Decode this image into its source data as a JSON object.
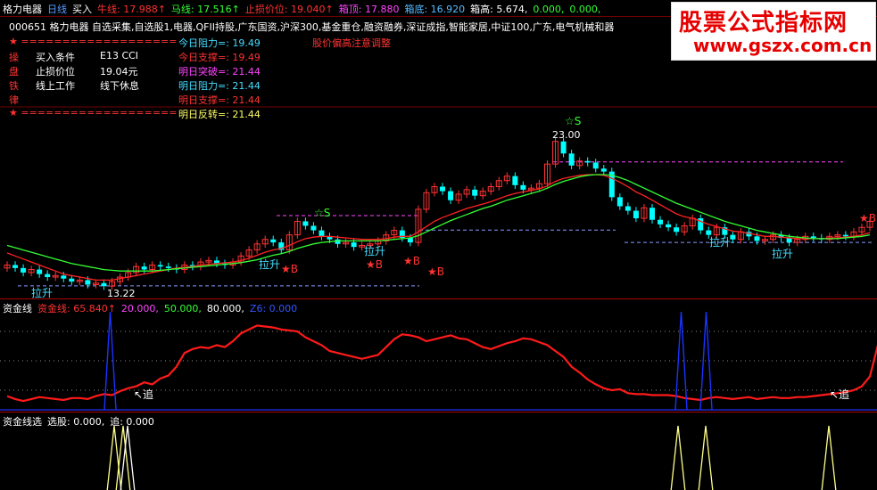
{
  "header": {
    "row1": [
      {
        "text": "格力电器",
        "color": "#ffffff"
      },
      {
        "text": "日线",
        "color": "#5599ff"
      },
      {
        "text": "买入",
        "color": "#ffffff"
      },
      {
        "text": "牛线: 17.988↑",
        "color": "#ff3333"
      },
      {
        "text": "马线: 17.516↑",
        "color": "#33ff33"
      },
      {
        "text": "止损价位: 19.040↑",
        "color": "#ff3333"
      },
      {
        "text": "箱顶: 17.880",
        "color": "#ff44ff"
      },
      {
        "text": "箱底: 16.920",
        "color": "#55bbff"
      },
      {
        "text": "箱高: 5.674,",
        "color": "#ffffff"
      },
      {
        "text": "0.000,",
        "color": "#33ff33"
      },
      {
        "text": "0.000,",
        "color": "#33ff33"
      }
    ],
    "row2": "000651  格力电器  自选采集,自选股1,电器,QFII持股,广东国资,沪深300,基金重仓,融资融券,深证成指,智能家居,中证100,广东,电气机械和器"
  },
  "info_left": {
    "rule1": "★ ===================",
    "lines": [
      {
        "char": "操",
        "a": "买入条件",
        "b": "E13 CCI"
      },
      {
        "char": "盘",
        "a": "止损价位",
        "b": "19.04元"
      },
      {
        "char": "铁",
        "a": "线上工作",
        "b": "线下休息"
      },
      {
        "char": "律",
        "a": "",
        "b": ""
      }
    ],
    "rule2": "★ ==================="
  },
  "info_right": [
    {
      "text": "今日阻力=: 19.49",
      "color": "#44ddff"
    },
    {
      "text": "今日支撑=: 19.49",
      "color": "#ff3333"
    },
    {
      "text": "明日突破=: 21.44",
      "color": "#ff44ff"
    },
    {
      "text": "明日阻力=: 21.44",
      "color": "#44ddff"
    },
    {
      "text": "明日支撑=: 21.44",
      "color": "#ff3333"
    },
    {
      "text": "明日反转=: 21.44",
      "color": "#ffff66"
    }
  ],
  "notice": "股价偏高注意调整",
  "logo": {
    "line1": "股票公式指标网",
    "line2": "www.gszx.com.cn"
  },
  "annotations": {
    "peak": "23.00",
    "low": "13.22",
    "lashen": "拉升",
    "star_s": "☆S",
    "star_b": "★B"
  },
  "panel2_header": [
    {
      "text": "资金线",
      "color": "#ffffff"
    },
    {
      "text": "资金线: 65.840↑",
      "color": "#ff3333"
    },
    {
      "text": "20.000,",
      "color": "#ff44ff"
    },
    {
      "text": "50.000,",
      "color": "#33ff33"
    },
    {
      "text": "80.000,",
      "color": "#ffffff"
    },
    {
      "text": "Z6: 0.000",
      "color": "#3355ff"
    }
  ],
  "panel2_label": "追",
  "panel3_header": [
    {
      "text": "资金线选",
      "color": "#ffffff"
    },
    {
      "text": "选股: 0.000,",
      "color": "#ffffff"
    },
    {
      "text": "追: 0.000",
      "color": "#ffffff"
    }
  ],
  "colors": {
    "up": "#ff3333",
    "down": "#00ffff",
    "ma_fast": "#ff2222",
    "ma_slow": "#33ff33",
    "capital": "#ff1a1a",
    "signal": "#1a33ff",
    "select": "#ffff88"
  },
  "chart_data": [
    {
      "type": "candlestick",
      "title": "格力电器 日线",
      "ylim": [
        12.5,
        24.5
      ],
      "closes": [
        14.6,
        14.4,
        14.1,
        14.3,
        14.0,
        13.8,
        13.9,
        13.7,
        13.5,
        13.6,
        13.3,
        13.4,
        13.2,
        13.5,
        13.8,
        14.1,
        14.5,
        14.3,
        14.6,
        14.5,
        14.4,
        14.3,
        14.6,
        14.5,
        14.8,
        14.9,
        14.7,
        14.6,
        14.8,
        15.2,
        15.6,
        16.0,
        16.3,
        16.1,
        15.6,
        16.6,
        17.5,
        17.2,
        16.9,
        16.5,
        16.3,
        16.0,
        16.1,
        15.8,
        15.9,
        16.0,
        16.2,
        16.6,
        16.9,
        16.4,
        16.1,
        18.3,
        19.4,
        19.8,
        19.5,
        18.9,
        19.3,
        19.6,
        19.2,
        19.5,
        19.8,
        20.2,
        20.5,
        19.9,
        19.6,
        19.7,
        20.0,
        21.3,
        22.8,
        22.0,
        21.2,
        21.5,
        21.4,
        21.0,
        20.8,
        19.1,
        18.5,
        18.2,
        17.7,
        18.4,
        17.6,
        17.3,
        17.1,
        16.8,
        17.2,
        17.7,
        16.9,
        16.6,
        17.1,
        16.6,
        16.3,
        16.8,
        16.5,
        16.2,
        16.3,
        16.6,
        16.4,
        16.1,
        16.3,
        16.5,
        16.4,
        16.3,
        16.5,
        16.6,
        16.5,
        16.8,
        17.1,
        17.5
      ],
      "ma_fast": [
        15.4,
        15.2,
        15.0,
        14.8,
        14.6,
        14.4,
        14.2,
        14.0,
        13.9,
        13.8,
        13.7,
        13.6,
        13.6,
        13.6,
        13.7,
        13.8,
        13.9,
        14.0,
        14.1,
        14.2,
        14.3,
        14.4,
        14.45,
        14.5,
        14.6,
        14.65,
        14.7,
        14.75,
        14.8,
        14.9,
        15.05,
        15.25,
        15.45,
        15.6,
        15.7,
        15.9,
        16.15,
        16.35,
        16.45,
        16.5,
        16.5,
        16.45,
        16.4,
        16.35,
        16.3,
        16.3,
        16.3,
        16.35,
        16.45,
        16.5,
        16.5,
        16.8,
        17.15,
        17.5,
        17.75,
        17.95,
        18.15,
        18.35,
        18.5,
        18.65,
        18.8,
        19.0,
        19.2,
        19.35,
        19.45,
        19.55,
        19.65,
        19.85,
        20.15,
        20.35,
        20.45,
        20.55,
        20.6,
        20.6,
        20.55,
        20.35,
        20.1,
        19.8,
        19.45,
        19.2,
        18.9,
        18.6,
        18.3,
        18.0,
        17.8,
        17.7,
        17.5,
        17.3,
        17.15,
        17.0,
        16.85,
        16.8,
        16.7,
        16.6,
        16.5,
        16.5,
        16.45,
        16.4,
        16.35,
        16.35,
        16.35,
        16.35,
        16.4,
        16.4,
        16.45,
        16.5,
        16.6,
        16.75
      ],
      "ma_slow": [
        15.9,
        15.75,
        15.6,
        15.45,
        15.3,
        15.15,
        15.0,
        14.85,
        14.7,
        14.6,
        14.5,
        14.4,
        14.3,
        14.25,
        14.2,
        14.2,
        14.2,
        14.2,
        14.2,
        14.25,
        14.3,
        14.35,
        14.4,
        14.45,
        14.5,
        14.55,
        14.6,
        14.65,
        14.7,
        14.75,
        14.85,
        14.95,
        15.1,
        15.25,
        15.35,
        15.5,
        15.7,
        15.85,
        16.0,
        16.1,
        16.15,
        16.2,
        16.2,
        16.2,
        16.2,
        16.2,
        16.2,
        16.25,
        16.3,
        16.35,
        16.4,
        16.55,
        16.8,
        17.05,
        17.3,
        17.55,
        17.75,
        17.95,
        18.15,
        18.35,
        18.5,
        18.7,
        18.9,
        19.05,
        19.2,
        19.35,
        19.5,
        19.7,
        19.95,
        20.15,
        20.3,
        20.45,
        20.55,
        20.6,
        20.6,
        20.55,
        20.4,
        20.2,
        19.95,
        19.7,
        19.45,
        19.2,
        18.95,
        18.7,
        18.5,
        18.3,
        18.1,
        17.9,
        17.7,
        17.5,
        17.35,
        17.2,
        17.05,
        16.9,
        16.8,
        16.7,
        16.6,
        16.5,
        16.45,
        16.4,
        16.35,
        16.35,
        16.35,
        16.35,
        16.4,
        16.45,
        16.5,
        16.6
      ],
      "support_levels": [
        13.22,
        16.1,
        16.92
      ],
      "resistance_levels": [
        17.88,
        21.44
      ]
    },
    {
      "type": "line",
      "title": "资金线",
      "ylim": [
        0,
        100
      ],
      "reference_lines": [
        20,
        50,
        80
      ],
      "series": [
        {
          "name": "资金线",
          "values": [
            14,
            11,
            9,
            11,
            13,
            12,
            11,
            10,
            12,
            12,
            11,
            14,
            16,
            15,
            19,
            22,
            24,
            28,
            26,
            32,
            35,
            44,
            58,
            62,
            64,
            63,
            66,
            64,
            70,
            78,
            82,
            86,
            85,
            84,
            82,
            81,
            80,
            74,
            70,
            66,
            60,
            58,
            56,
            54,
            52,
            54,
            56,
            64,
            72,
            77,
            76,
            74,
            70,
            72,
            74,
            76,
            73,
            72,
            68,
            64,
            62,
            65,
            68,
            70,
            73,
            72,
            69,
            66,
            60,
            54,
            44,
            38,
            31,
            26,
            22,
            20,
            21,
            17,
            16,
            16,
            15,
            15,
            15,
            14,
            12,
            11,
            10,
            12,
            13,
            12,
            11,
            12,
            13,
            11,
            12,
            13,
            12,
            12,
            13,
            13,
            14,
            15,
            16,
            17,
            18,
            20,
            24,
            34,
            66
          ]
        },
        {
          "name": "Z6",
          "values": [
            0,
            0,
            0,
            0,
            0,
            0,
            0,
            0,
            0,
            0,
            0,
            0,
            0,
            0,
            0,
            0,
            0,
            0,
            0,
            0,
            0,
            0,
            0,
            0,
            0,
            0,
            0,
            0,
            0,
            0,
            0,
            0,
            0,
            0,
            0,
            0,
            0,
            0,
            0,
            0,
            0,
            0,
            0,
            0,
            0,
            0,
            0,
            0,
            0,
            0,
            0,
            0,
            0,
            0,
            0,
            0,
            0,
            0,
            0,
            0,
            0,
            0,
            0,
            0,
            0,
            0,
            0,
            0,
            0,
            0,
            0,
            0,
            0,
            0,
            0,
            0,
            0,
            0,
            0,
            0,
            0,
            0,
            0,
            0,
            0,
            0,
            0,
            0,
            0,
            0,
            0,
            0,
            0,
            0,
            0,
            0,
            0,
            0,
            0,
            0,
            0,
            0,
            0,
            0,
            0,
            0,
            0,
            0
          ]
        }
      ]
    }
  ]
}
